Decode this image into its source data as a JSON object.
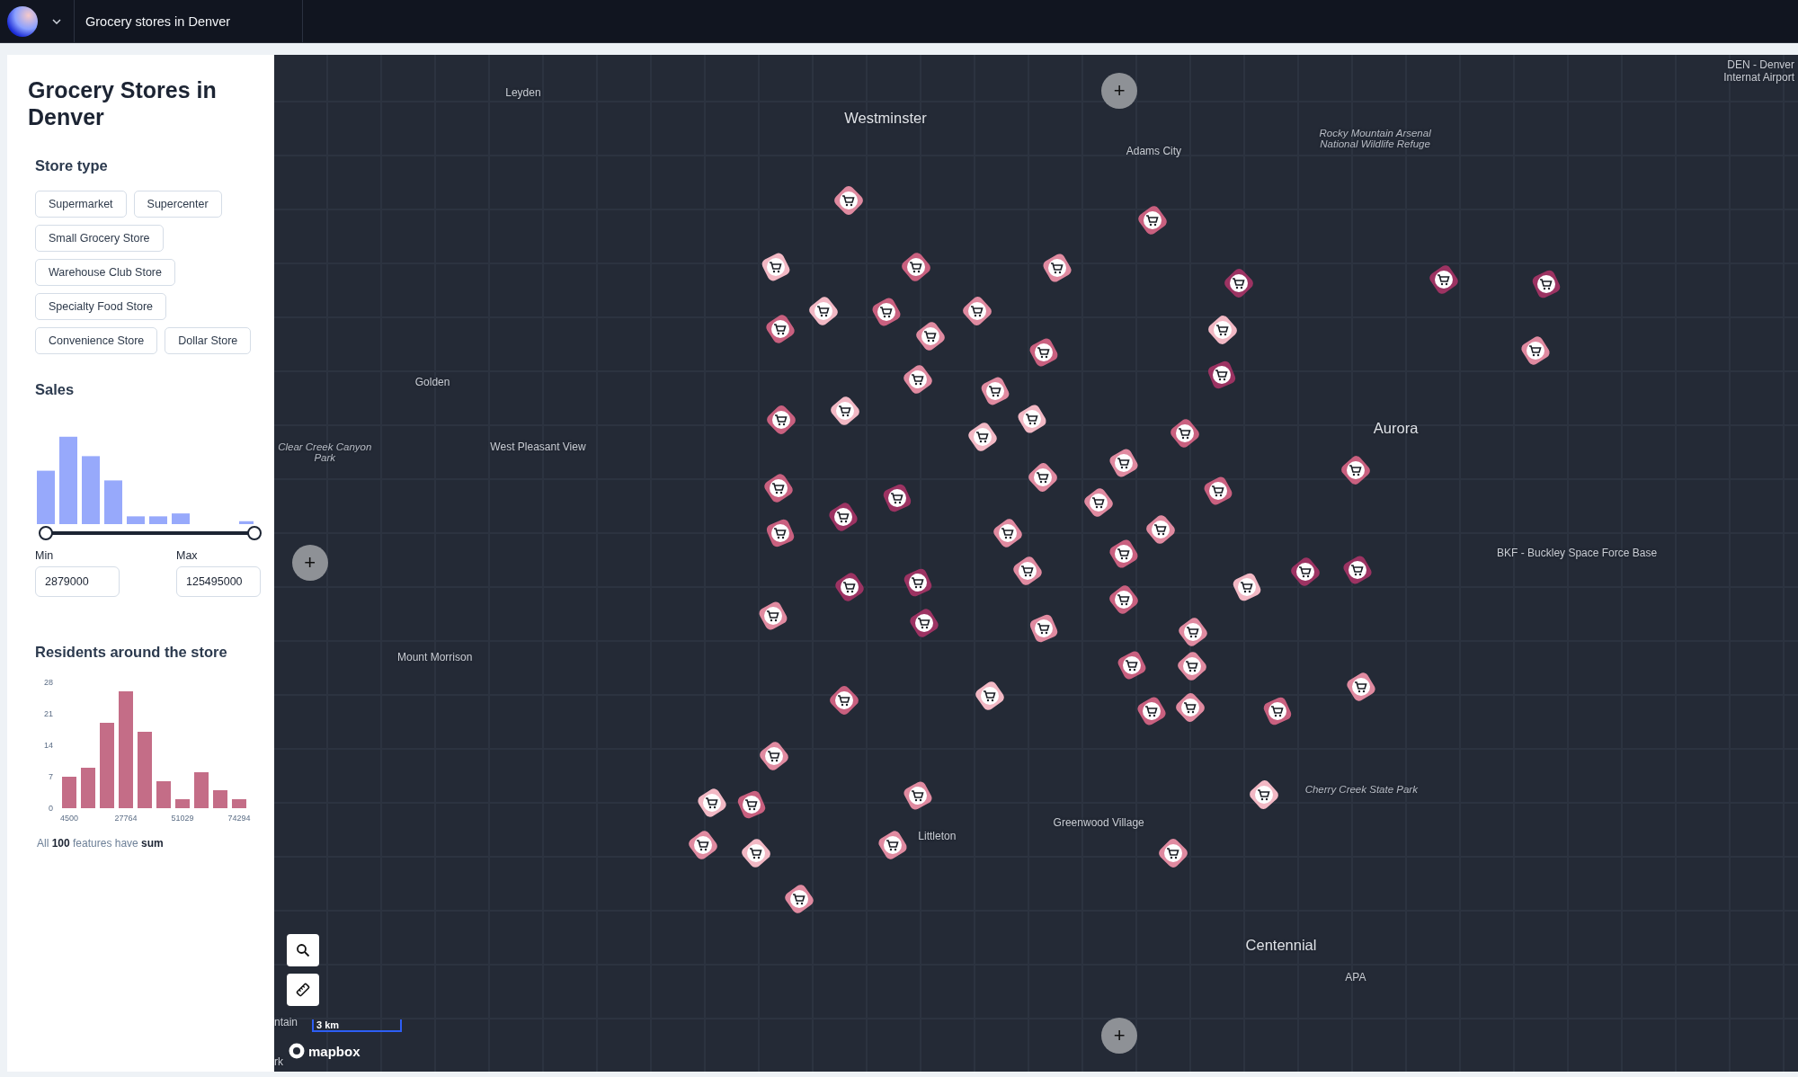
{
  "topbar": {
    "title": "Grocery stores in Denver"
  },
  "sidebar": {
    "title": "Grocery Stores in Denver",
    "store_type": {
      "heading": "Store type",
      "chips": [
        {
          "label": "Supermarket"
        },
        {
          "label": "Supercenter"
        },
        {
          "label": "Small Grocery Store"
        },
        {
          "label": "Warehouse Club Store"
        },
        {
          "label": "Specialty Food Store"
        },
        {
          "label": "Convenience Store"
        },
        {
          "label": "Dollar Store"
        }
      ]
    },
    "sales": {
      "heading": "Sales",
      "thumbs": [
        {
          "level": 0
        },
        {
          "level": 1
        }
      ],
      "min": {
        "label": "Min",
        "value": "2879000"
      },
      "max": {
        "label": "Max",
        "value": "125495000"
      }
    },
    "residents": {
      "heading": "Residents around the store",
      "chart_data": {
        "type": "bar",
        "categories": [
          "4500",
          null,
          null,
          "27764",
          null,
          null,
          "51029",
          null,
          null,
          "74294"
        ],
        "values": [
          7,
          9,
          19,
          26,
          17,
          6,
          2,
          8,
          4,
          2
        ],
        "ylim": [
          0,
          28
        ],
        "yticks": [
          {
            "value": 0,
            "label": "0"
          },
          {
            "value": 7,
            "label": "7"
          },
          {
            "value": 14,
            "label": "14"
          },
          {
            "value": 21,
            "label": "21"
          },
          {
            "value": 28,
            "label": "28"
          }
        ]
      },
      "footer": "All **100** features have **sum**"
    }
  },
  "map": {
    "labels": [
      {
        "text": "Leyden",
        "kind": "place"
      },
      {
        "text": "Westminster",
        "kind": "city"
      },
      {
        "text": "Adams City",
        "kind": "place"
      },
      {
        "text": "Rocky Mountain Arsenal National Wildlife Refuge",
        "kind": "park"
      },
      {
        "text": "DEN - Denver Internat Airport",
        "kind": "airport"
      },
      {
        "text": "Golden",
        "kind": "place"
      },
      {
        "text": "Clear Creek Canyon Park",
        "kind": "park"
      },
      {
        "text": "West Pleasant View",
        "kind": "place"
      },
      {
        "text": "Aurora",
        "kind": "city"
      },
      {
        "text": "BKF - Buckley Space Force Base",
        "kind": "place"
      },
      {
        "text": "Mount Morrison",
        "kind": "place"
      },
      {
        "text": "Cherry Creek State Park",
        "kind": "park"
      },
      {
        "text": "Greenwood Village",
        "kind": "place"
      },
      {
        "text": "Littleton",
        "kind": "place"
      },
      {
        "text": "Centennial",
        "kind": "city"
      },
      {
        "text": "APA",
        "kind": "place"
      },
      {
        "text": "ntain",
        "kind": "edge"
      },
      {
        "text": "rk",
        "kind": "edge"
      }
    ],
    "zoom_buttons": [
      "+",
      "+",
      "+"
    ],
    "scale": "3 km",
    "attribution": "mapbox"
  }
}
